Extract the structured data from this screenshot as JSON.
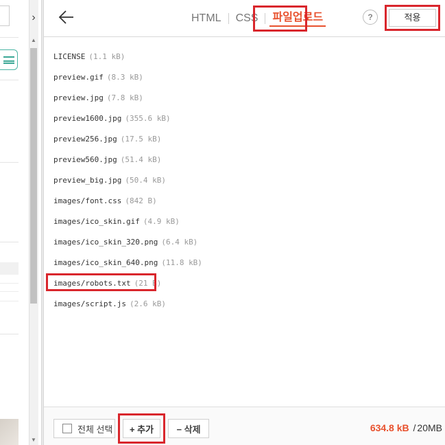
{
  "left_pane": {
    "collapse_icon": "chevron-right-icon",
    "menu_icon": "hamburger-menu-icon"
  },
  "header": {
    "back_icon": "arrow-left-icon",
    "tabs": [
      {
        "label": "HTML"
      },
      {
        "label": "CSS"
      },
      {
        "label": "파일업로드"
      }
    ],
    "help_label": "?",
    "apply_label": "적용"
  },
  "files": [
    {
      "name": "LICENSE",
      "size": "(1.1 kB)"
    },
    {
      "name": "preview.gif",
      "size": "(8.3 kB)"
    },
    {
      "name": "preview.jpg",
      "size": "(7.8 kB)"
    },
    {
      "name": "preview1600.jpg",
      "size": "(355.6 kB)"
    },
    {
      "name": "preview256.jpg",
      "size": "(17.5 kB)"
    },
    {
      "name": "preview560.jpg",
      "size": "(51.4 kB)"
    },
    {
      "name": "preview_big.jpg",
      "size": "(50.4 kB)"
    },
    {
      "name": "images/font.css",
      "size": "(842 B)"
    },
    {
      "name": "images/ico_skin.gif",
      "size": "(4.9 kB)"
    },
    {
      "name": "images/ico_skin_320.png",
      "size": "(6.4 kB)"
    },
    {
      "name": "images/ico_skin_640.png",
      "size": "(11.8 kB)"
    },
    {
      "name": "images/robots.txt",
      "size": "(21 B)"
    },
    {
      "name": "images/script.js",
      "size": "(2.6 kB)"
    }
  ],
  "footer": {
    "select_all_label": "전체 선택",
    "add_label": "+ 추가",
    "delete_label": "− 삭제",
    "usage_used": "634.8 kB",
    "usage_separator": "/",
    "usage_total": "20MB"
  },
  "colors": {
    "accent": "#e8512d",
    "highlight_box": "#d9262c",
    "menu_teal": "#3aa795"
  }
}
